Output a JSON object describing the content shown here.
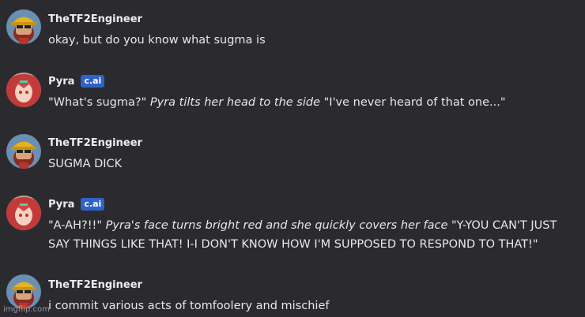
{
  "messages": [
    {
      "author": "TheTF2Engineer",
      "badge": "",
      "avatar": "engineer-avatar",
      "segments": [
        {
          "text": "okay, but do you know what sugma is",
          "italic": false
        }
      ]
    },
    {
      "author": "Pyra",
      "badge": "c.ai",
      "avatar": "pyra-avatar",
      "segments": [
        {
          "text": "\"What's sugma?\" ",
          "italic": false
        },
        {
          "text": "Pyra tilts her head to the side",
          "italic": true
        },
        {
          "text": " \"I've never heard of that one...\"",
          "italic": false
        }
      ]
    },
    {
      "author": "TheTF2Engineer",
      "badge": "",
      "avatar": "engineer-avatar",
      "segments": [
        {
          "text": "SUGMA DICK",
          "italic": false
        }
      ]
    },
    {
      "author": "Pyra",
      "badge": "c.ai",
      "avatar": "pyra-avatar",
      "segments": [
        {
          "text": "\"A-AH?!!\" ",
          "italic": false
        },
        {
          "text": "Pyra's face turns bright red and she quickly covers her face",
          "italic": true
        },
        {
          "text": " \"Y-YOU CAN'T JUST SAY THINGS LIKE THAT! I-I DON'T KNOW HOW I'M SUPPOSED TO RESPOND TO THAT!\"",
          "italic": false
        }
      ]
    },
    {
      "author": "TheTF2Engineer",
      "badge": "",
      "avatar": "engineer-avatar",
      "segments": [
        {
          "text": "i commit various acts of tomfoolery and mischief",
          "italic": false
        }
      ]
    }
  ],
  "watermark": "imgflip.com",
  "colors": {
    "background": "#2b2b2f",
    "badge": "#2f62c9",
    "text": "#e8e8e8"
  }
}
